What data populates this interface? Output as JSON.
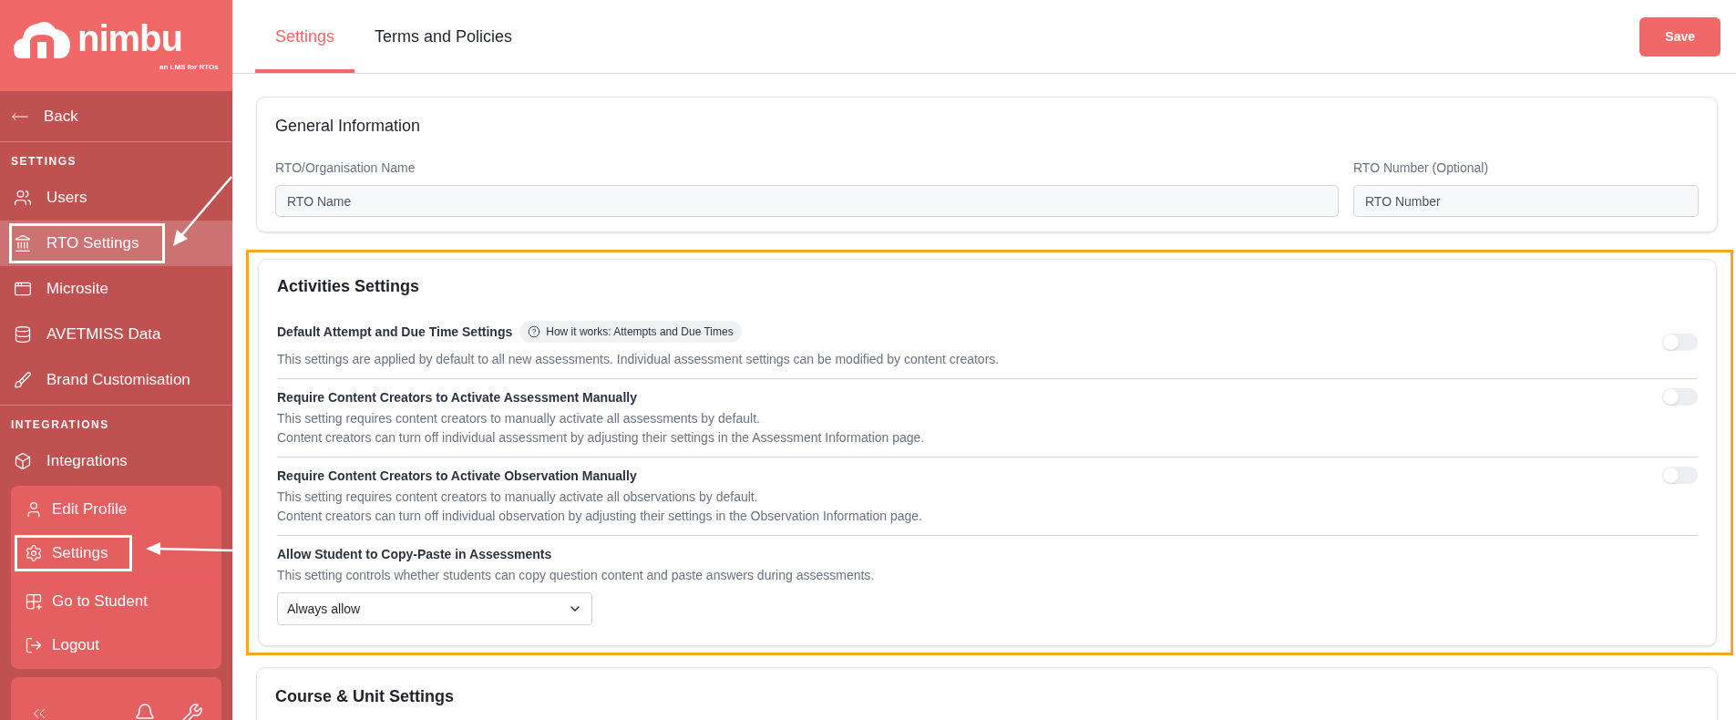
{
  "logo": {
    "name": "nimbu",
    "tagline": "an LMS for RTOs"
  },
  "sidebar": {
    "back": "Back",
    "sections": [
      {
        "heading": "SETTINGS",
        "items": [
          {
            "label": "Users",
            "selected": false,
            "outlined": false
          },
          {
            "label": "RTO Settings",
            "selected": true,
            "outlined": true
          },
          {
            "label": "Microsite",
            "selected": false,
            "outlined": false
          },
          {
            "label": "AVETMISS Data",
            "selected": false,
            "outlined": false
          },
          {
            "label": "Brand Customisation",
            "selected": false,
            "outlined": false
          }
        ]
      },
      {
        "heading": "INTEGRATIONS",
        "items": [
          {
            "label": "Integrations",
            "selected": false,
            "outlined": false
          }
        ]
      }
    ]
  },
  "user_menu": {
    "items": [
      {
        "label": "Edit Profile",
        "outlined": false
      },
      {
        "label": "Settings",
        "outlined": true
      },
      {
        "label": "Go to Student",
        "outlined": false
      },
      {
        "label": "Logout",
        "outlined": false
      }
    ]
  },
  "tabs": [
    {
      "label": "Settings",
      "selected": true
    },
    {
      "label": "Terms and Policies",
      "selected": false
    }
  ],
  "save_button": "Save",
  "general": {
    "title": "General Information",
    "fields": [
      {
        "label": "RTO/Organisation Name",
        "placeholder": "RTO Name"
      },
      {
        "label": "RTO Number (Optional)",
        "placeholder": "RTO Number"
      }
    ]
  },
  "activities": {
    "title": "Activities Settings",
    "outlined": true,
    "settings": [
      {
        "kind": "toggle",
        "label": "Default Attempt and Due Time Settings",
        "help": "How it works: Attempts and Due Times",
        "lines": [
          "This settings are applied by default to all new assessments. Individual assessment settings can be modified by content creators."
        ],
        "on": false
      },
      {
        "kind": "toggle",
        "label": "Require Content Creators to Activate Assessment Manually",
        "lines": [
          "This setting requires content creators to manually activate all assessments by default.",
          "Content creators can turn off individual assessment by adjusting their settings in the Assessment Information page."
        ],
        "on": false
      },
      {
        "kind": "toggle",
        "label": "Require Content Creators to Activate Observation Manually",
        "lines": [
          "This setting requires content creators to manually activate all observations by default.",
          "Content creators can turn off individual observation by adjusting their settings in the Observation Information page."
        ],
        "on": false
      },
      {
        "kind": "select",
        "label": "Allow Student to Copy-Paste in Assessments",
        "lines": [
          "This setting controls whether students can copy question content and paste answers during assessments."
        ],
        "value": "Always allow"
      }
    ]
  },
  "next_card": {
    "title": "Course & Unit Settings"
  }
}
